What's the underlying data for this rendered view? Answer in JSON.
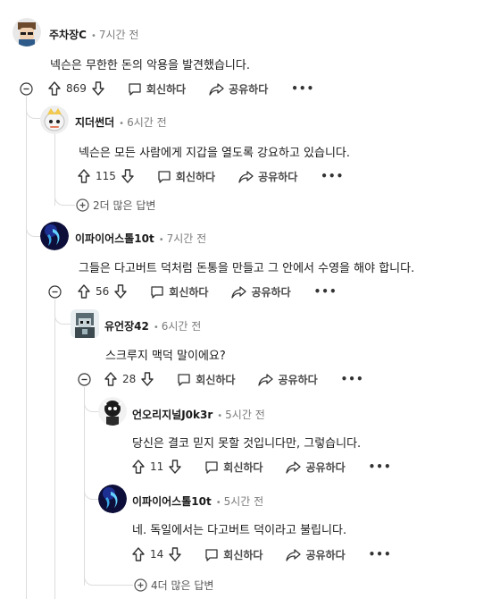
{
  "actions": {
    "reply": "회신하다",
    "share": "공유하다",
    "more": "•••"
  },
  "comments": [
    {
      "author": "주차장C",
      "time": "7시간 전",
      "body": "넥슨은 무한한 돈의 악용을 발견했습니다.",
      "votes": "869"
    },
    {
      "author": "지더썬더",
      "time": "6시간 전",
      "body": "넥슨은 모든 사람에게 지갑을 열도록 강요하고 있습니다.",
      "votes": "115"
    },
    {
      "author": "이파이어스톨10t",
      "time": "7시간 전",
      "body": "그들은 다고버트 덕처럼 돈통을 만들고 그 안에서 수영을 해야 합니다.",
      "votes": "56"
    },
    {
      "author": "유언장42",
      "time": "6시간 전",
      "body": "스크루지 맥덕 말이에요?",
      "votes": "28"
    },
    {
      "author": "언오리지널J0k3r",
      "time": "5시간 전",
      "body": "당신은 결코 믿지 못할 것입니다만, 그렇습니다.",
      "votes": "11"
    },
    {
      "author": "이파이어스톨10t",
      "time": "5시간 전",
      "body": "네. 독일에서는 다고버트 덕이라고 불립니다.",
      "votes": "14"
    }
  ],
  "more_replies": {
    "first": "2더 많은 답변",
    "second": "4더 많은 답변"
  }
}
